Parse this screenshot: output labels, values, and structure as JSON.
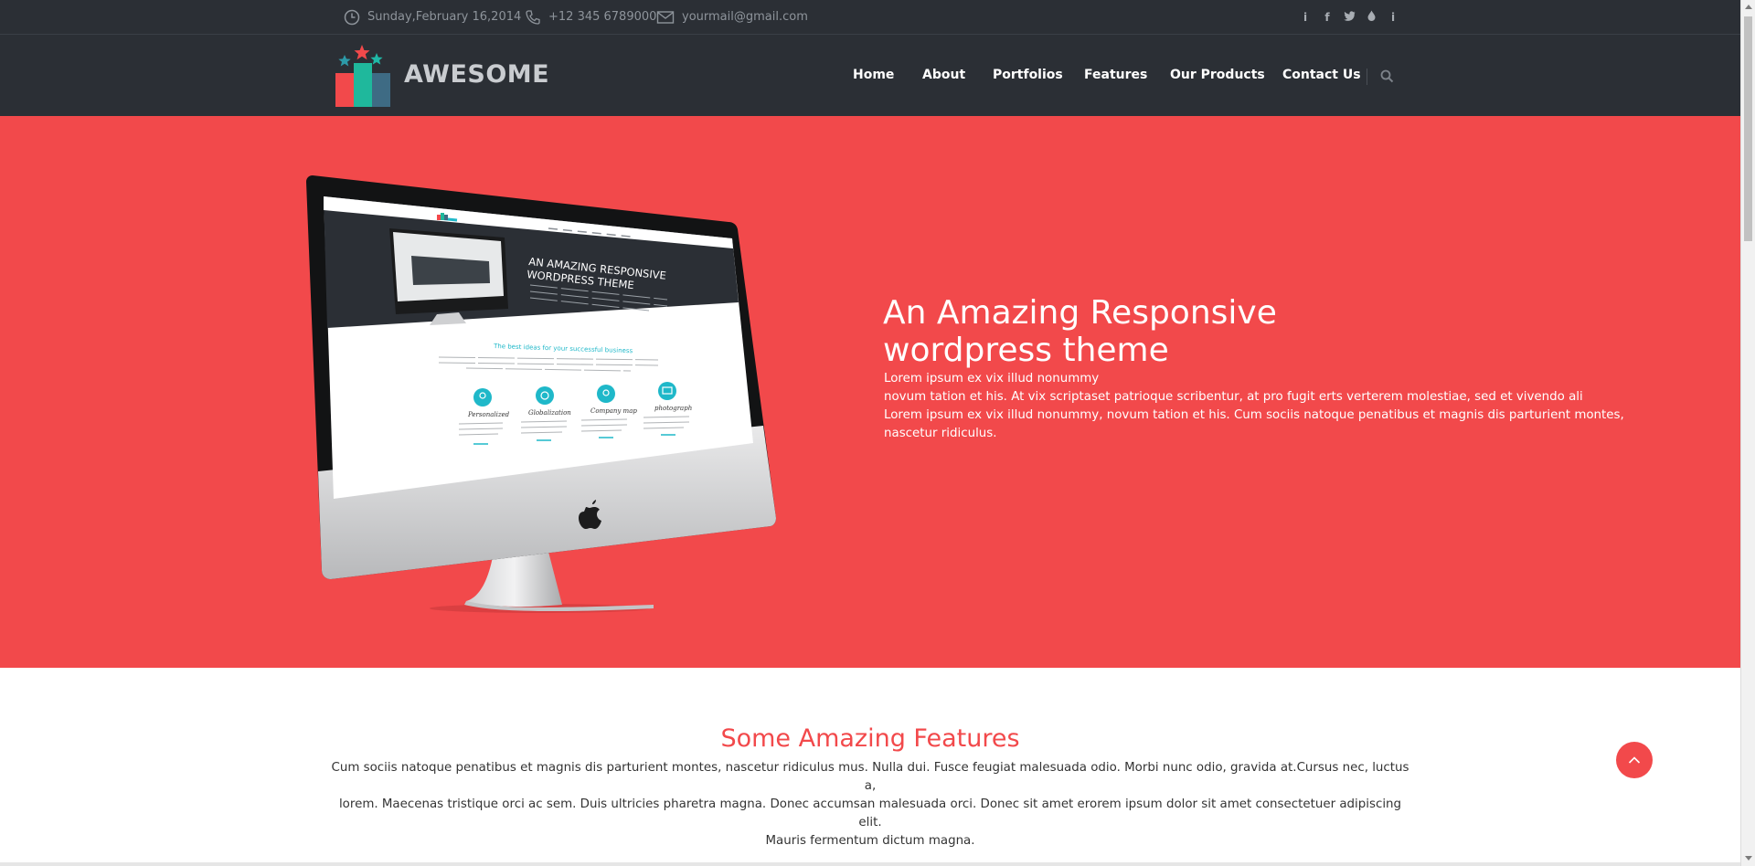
{
  "topbar": {
    "date": "Sunday,February 16,2014",
    "phone": "+12 345 6789000",
    "email": "yourmail@gmail.com",
    "social_icons": [
      "info-icon",
      "facebook-icon",
      "twitter-icon",
      "drop-icon",
      "info-icon"
    ],
    "social_glyphs": [
      "i",
      "f",
      "t",
      "◆",
      "i"
    ]
  },
  "header": {
    "logo_text": "AWESOME",
    "nav": [
      "Home",
      "About",
      "Portfolios",
      "Features",
      "Our Products",
      "Contact Us"
    ]
  },
  "hero": {
    "title_line1": "An Amazing Responsive",
    "title_line2": "wordpress theme",
    "text_lines": [
      "Lorem ipsum ex vix illud nonummy",
      "novum tation et his. At vix scriptaset patrioque scribentur, at pro fugit erts verterem molestiae, sed et vivendo ali",
      "Lorem ipsum ex vix illud nonummy, novum tation et his. Cum sociis natoque penatibus et magnis dis parturient montes,",
      "nascetur ridiculus."
    ],
    "screen": {
      "heading_line1": "AN AMAZING RESPONSIVE",
      "heading_line2": "WORDPRESS THEME",
      "logo_text": "AWESOME",
      "tagline": "The best ideas for your successful business",
      "features": [
        "Personalized",
        "Globalization",
        "Company map",
        "photograph"
      ]
    }
  },
  "features": {
    "title": "Some Amazing Features",
    "text_lines": [
      "Cum sociis natoque penatibus et magnis dis parturient montes, nascetur ridiculus mus. Nulla dui. Fusce feugiat malesuada odio. Morbi nunc odio, gravida at.Cursus nec, luctus a,",
      "lorem. Maecenas tristique orci ac sem. Duis ultricies pharetra magna. Donec accumsan malesuada orci. Donec sit amet erorem ipsum dolor sit amet consectetuer adipiscing elit.",
      "Mauris fermentum dictum magna."
    ]
  },
  "colors": {
    "brand_red": "#f2494b",
    "header_dark": "#2b2f35",
    "screen_cyan": "#1fb8c9"
  }
}
